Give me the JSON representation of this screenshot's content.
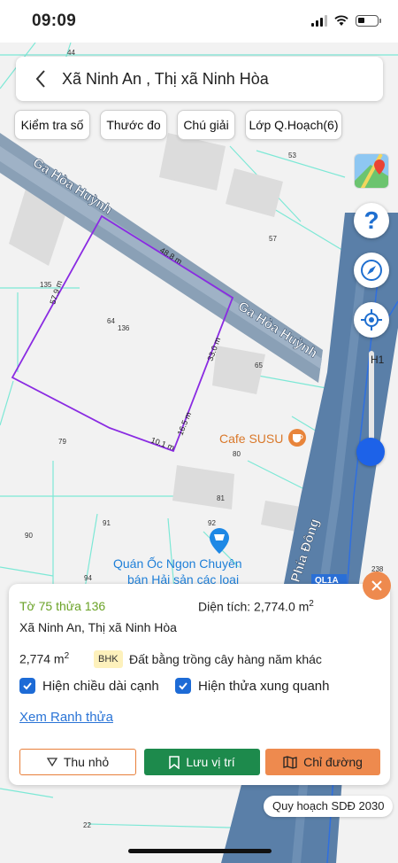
{
  "status_bar": {
    "time": "09:09"
  },
  "header": {
    "title": "Xã Ninh An , Thị xã Ninh Hòa"
  },
  "toolbar": {
    "chips": [
      "Kiểm tra số",
      "Thước đo",
      "Chú giải",
      "Lớp Q.Hoạch(6)"
    ]
  },
  "map": {
    "road_name_1": "Ga Hòa Huỳnh",
    "road_name_2": "Ga Hòa Huỳnh",
    "road_name_3": "Phía Đông",
    "road_code": "QL1A",
    "edges": [
      "48.8 m",
      "57.9 m",
      "33.0 m",
      "16.5 m",
      "10.1 m"
    ],
    "parcel_numbers": [
      "44",
      "53",
      "57",
      "135",
      "64",
      "136",
      "65",
      "79",
      "80",
      "81",
      "91",
      "92",
      "90",
      "94",
      "22",
      "238"
    ],
    "cafe": "Cafe SUSU",
    "shop_line1": "Quán Ốc Ngon Chuyên",
    "shop_line2": "bán Hải sản các loại",
    "slider_label": "H1",
    "colors": {
      "boundary": "#8a2be2",
      "road": "#5a7fa8",
      "accent": "#1d62e8"
    }
  },
  "panel": {
    "parcel_id": "Tờ 75 thửa 136",
    "area_label": "Diện tích: 2,774.0 m",
    "area_sup": "2",
    "location": "Xã Ninh An, Thị xã Ninh Hòa",
    "size": "2,774 m",
    "size_sup": "2",
    "land_code": "BHK",
    "land_desc": "Đất bằng trồng cây hàng năm khác",
    "check_edges": "Hiện chiều dài cạnh",
    "check_neighbors": "Hiện thửa xung quanh",
    "link": "Xem Ranh thửa",
    "btn_shrink": "Thu nhỏ",
    "btn_save": "Lưu vị trí",
    "btn_route": "Chỉ đường"
  },
  "plan_badge": "Quy hoạch SDĐ 2030"
}
